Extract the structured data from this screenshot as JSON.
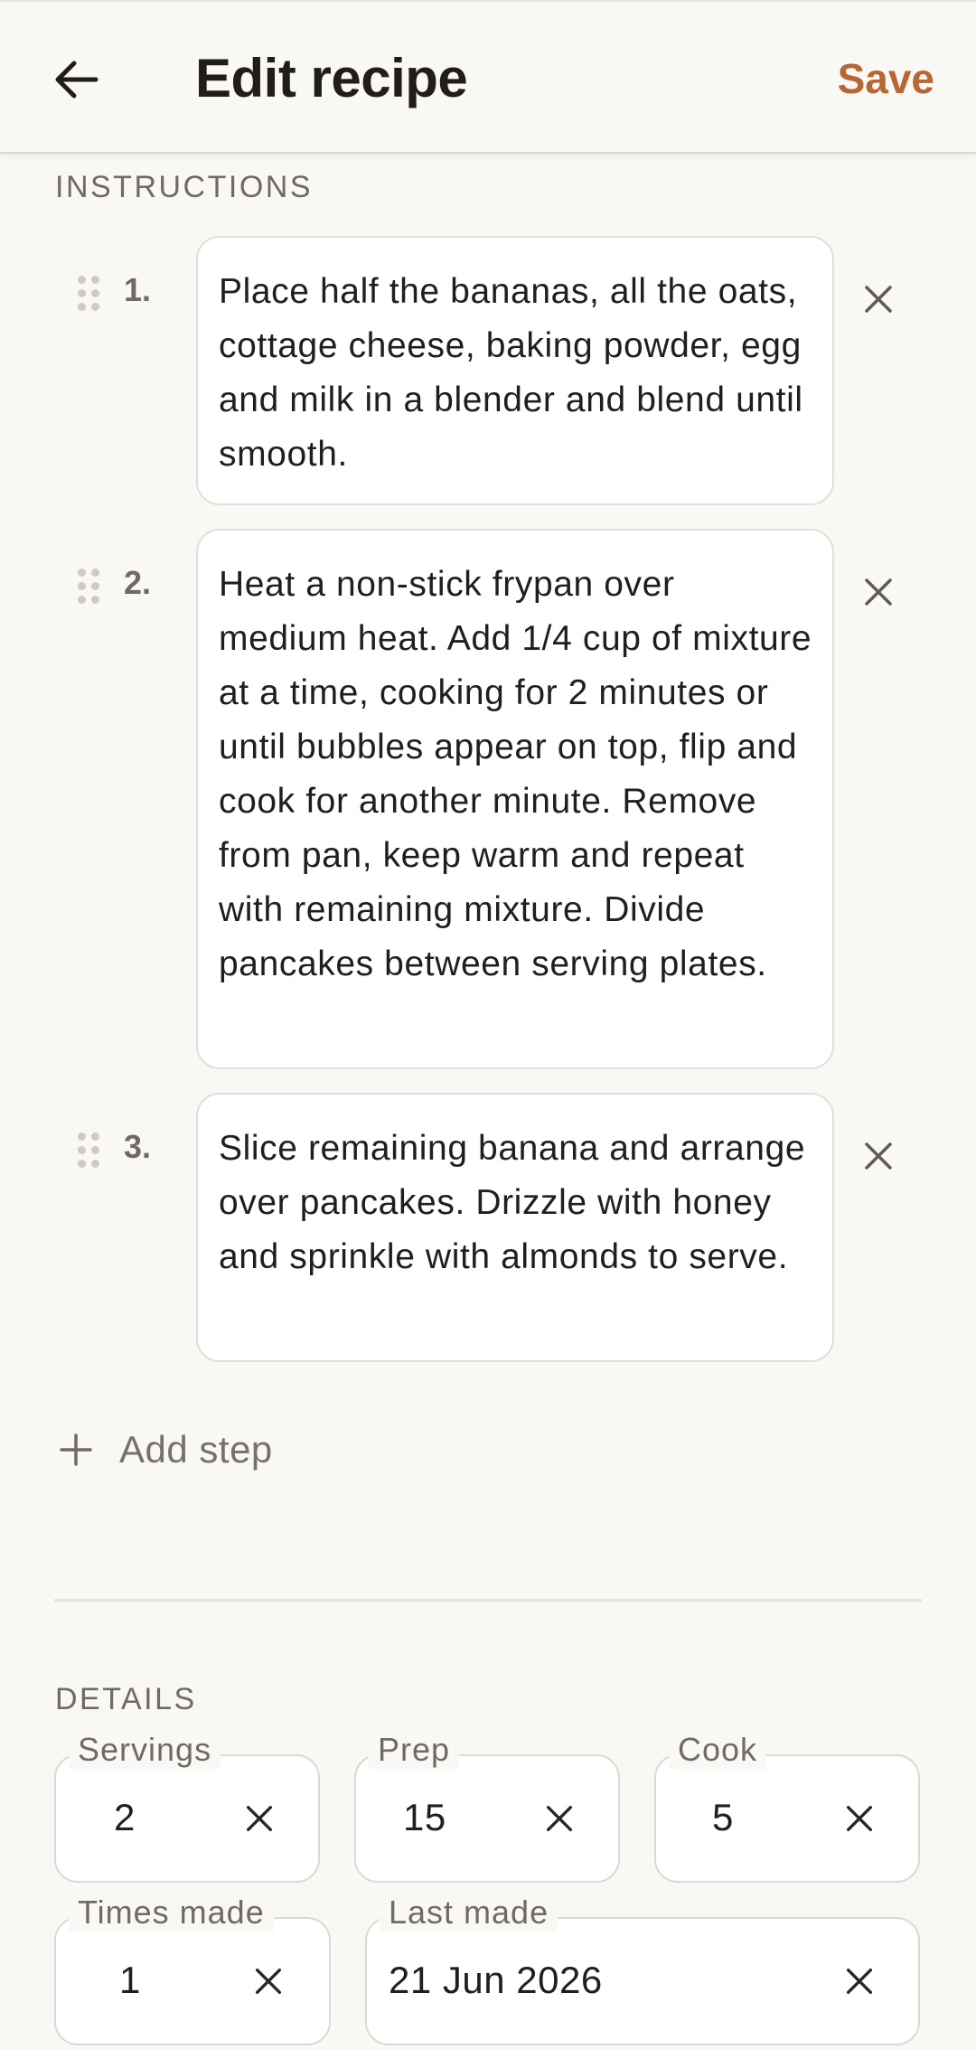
{
  "header": {
    "title": "Edit recipe",
    "save_label": "Save",
    "back_icon": "arrow-left-icon"
  },
  "instructions": {
    "section_label": "INSTRUCTIONS",
    "steps": [
      {
        "number": "1.",
        "text": "Place half the bananas, all the oats, cottage cheese, baking powder, egg and milk in a blender and blend until smooth."
      },
      {
        "number": "2.",
        "text": "Heat a non-stick frypan over medium heat. Add 1/4 cup of mixture at a time, cooking for 2 minutes or until bubbles appear on top, flip and cook for another minute. Remove from pan, keep warm and repeat with remaining mixture. Divide pancakes between serving plates."
      },
      {
        "number": "3.",
        "text": "Slice remaining banana and arrange over pancakes. Drizzle with honey and sprinkle with almonds to serve."
      }
    ],
    "add_step_label": "Add step"
  },
  "details": {
    "section_label": "DETAILS",
    "servings": {
      "label": "Servings",
      "value": "2"
    },
    "prep": {
      "label": "Prep",
      "value": "15"
    },
    "cook": {
      "label": "Cook",
      "value": "5"
    },
    "times_made": {
      "label": "Times made",
      "value": "1"
    },
    "last_made": {
      "label": "Last made",
      "value": "21 Jun 2026"
    }
  },
  "colors": {
    "accent": "#b86633",
    "background": "#f9f8f5"
  }
}
